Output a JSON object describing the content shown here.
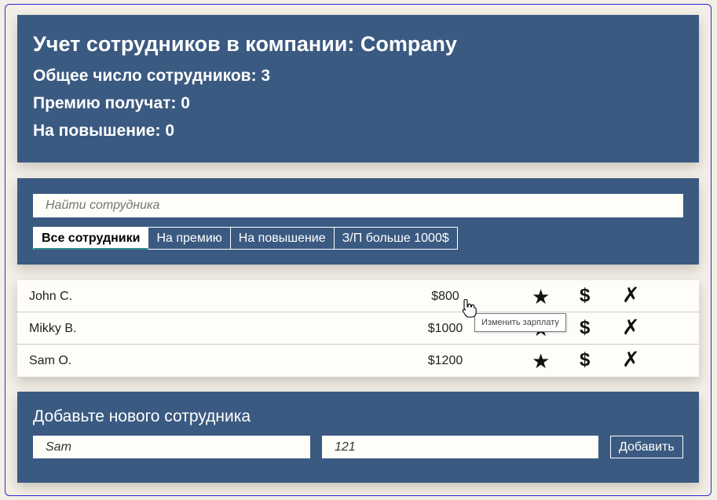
{
  "info": {
    "title": "Учет сотрудников в компании: Company",
    "total": "Общее число сотрудников: 3",
    "bonus": "Премию получат: 0",
    "promotion": "На повышение: 0"
  },
  "search": {
    "placeholder": "Найти сотрудника"
  },
  "filters": [
    "Все сотрудники",
    "На премию",
    "На повышение",
    "З/П больше 1000$"
  ],
  "employees": [
    {
      "name": "John C.",
      "salary": "$800"
    },
    {
      "name": "Mikky B.",
      "salary": "$1000"
    },
    {
      "name": "Sam O.",
      "salary": "$1200"
    }
  ],
  "row_icons": {
    "star": "★",
    "dollar": "$",
    "delete": "✗"
  },
  "tooltip": "Изменить зарплату",
  "add_form": {
    "title": "Добавьте нового сотрудника",
    "name_value": "Sam",
    "salary_value": "121",
    "button": "Добавить"
  },
  "colors": {
    "panel": "#3b5a81",
    "background": "#f3efe6",
    "active_tab_underline": "#2f8a8a"
  }
}
